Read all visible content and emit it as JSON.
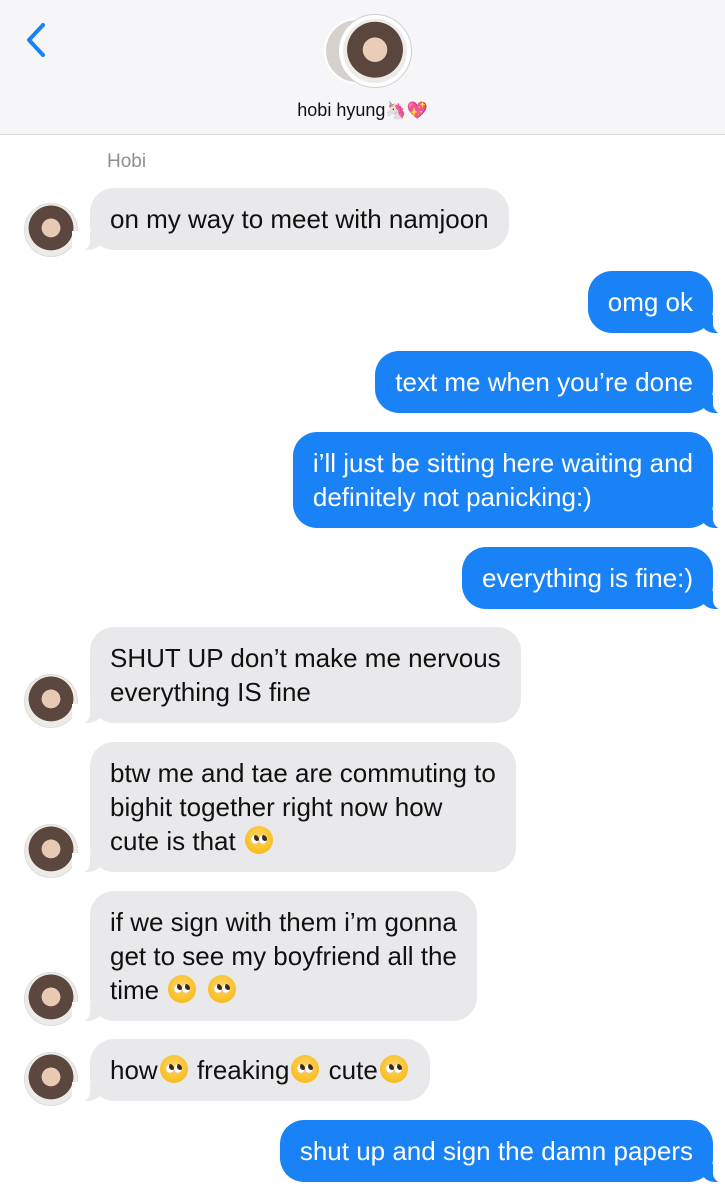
{
  "header": {
    "back_icon": "chevron-left-icon",
    "contact_name": "hobi hyung",
    "contact_emojis": "🦄💖",
    "accent_color": "#1a82f7"
  },
  "thread": {
    "sender_label": "Hobi",
    "messages": [
      {
        "direction": "incoming",
        "text": "on my way to meet with namjoon"
      },
      {
        "direction": "outgoing",
        "text": "omg ok"
      },
      {
        "direction": "outgoing",
        "text": "text me when you’re done"
      },
      {
        "direction": "outgoing",
        "text": "i’ll just be sitting here waiting and\ndefinitely not panicking:)"
      },
      {
        "direction": "outgoing",
        "text": "everything is fine:)"
      },
      {
        "direction": "incoming",
        "text": "SHUT UP don’t make me nervous\neverything IS fine"
      },
      {
        "direction": "incoming",
        "text": "btw me and tae are commuting to\nbighit together right now how\ncute is that"
      },
      {
        "direction": "incoming",
        "text": "if we sign with them i’m gonna\nget to see my boyfriend all the\ntime"
      },
      {
        "direction": "incoming",
        "parts": [
          "how",
          "freaking",
          "cute"
        ]
      },
      {
        "direction": "outgoing",
        "text": "shut up and sign the damn papers"
      }
    ],
    "emoji_icon": "pleading-face-icon",
    "bubble_colors": {
      "incoming": "#e9e9eb",
      "outgoing": "#1a82f7"
    }
  }
}
